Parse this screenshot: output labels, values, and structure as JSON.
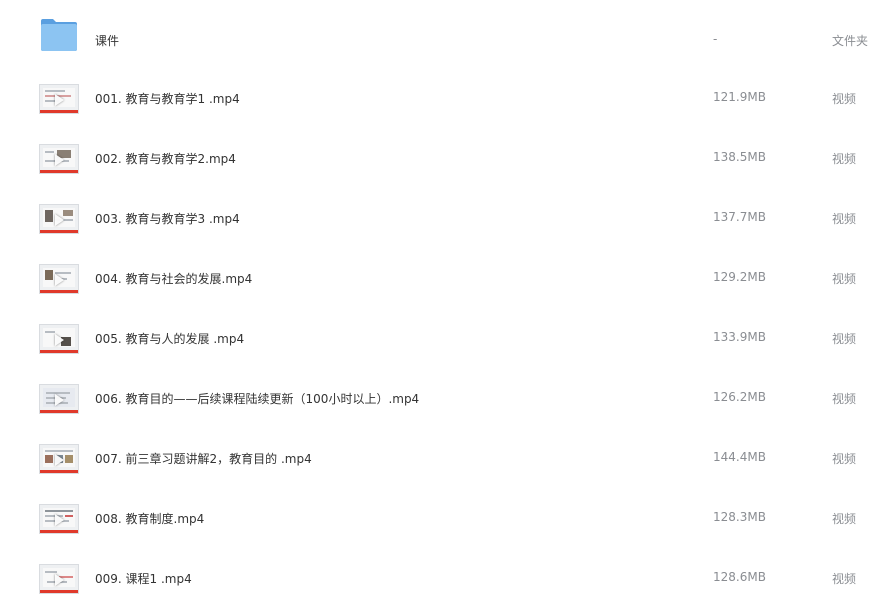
{
  "files": [
    {
      "name": "课件",
      "size": "-",
      "type": "文件夹",
      "icon": "folder-icon"
    },
    {
      "name": "001. 教育与教育学1 .mp4",
      "size": "121.9MB",
      "type": "视频",
      "icon": "video-thumbnail"
    },
    {
      "name": "002. 教育与教育学2.mp4",
      "size": "138.5MB",
      "type": "视频",
      "icon": "video-thumbnail"
    },
    {
      "name": "003. 教育与教育学3 .mp4",
      "size": "137.7MB",
      "type": "视频",
      "icon": "video-thumbnail"
    },
    {
      "name": "004. 教育与社会的发展.mp4",
      "size": "129.2MB",
      "type": "视频",
      "icon": "video-thumbnail"
    },
    {
      "name": "005. 教育与人的发展 .mp4",
      "size": "133.9MB",
      "type": "视频",
      "icon": "video-thumbnail"
    },
    {
      "name": "006. 教育目的——后续课程陆续更新（100小时以上）.mp4",
      "size": "126.2MB",
      "type": "视频",
      "icon": "video-thumbnail"
    },
    {
      "name": "007. 前三章习题讲解2，教育目的 .mp4",
      "size": "144.4MB",
      "type": "视频",
      "icon": "video-thumbnail"
    },
    {
      "name": "008. 教育制度.mp4",
      "size": "128.3MB",
      "type": "视频",
      "icon": "video-thumbnail"
    },
    {
      "name": "009. 课程1 .mp4",
      "size": "128.6MB",
      "type": "视频",
      "icon": "video-thumbnail"
    }
  ],
  "colors": {
    "folder": "#7db8ee",
    "folder_dark": "#5a9fe0",
    "thumb_bar": "#e0392b",
    "text": "#333333",
    "meta": "#8a8d92"
  }
}
